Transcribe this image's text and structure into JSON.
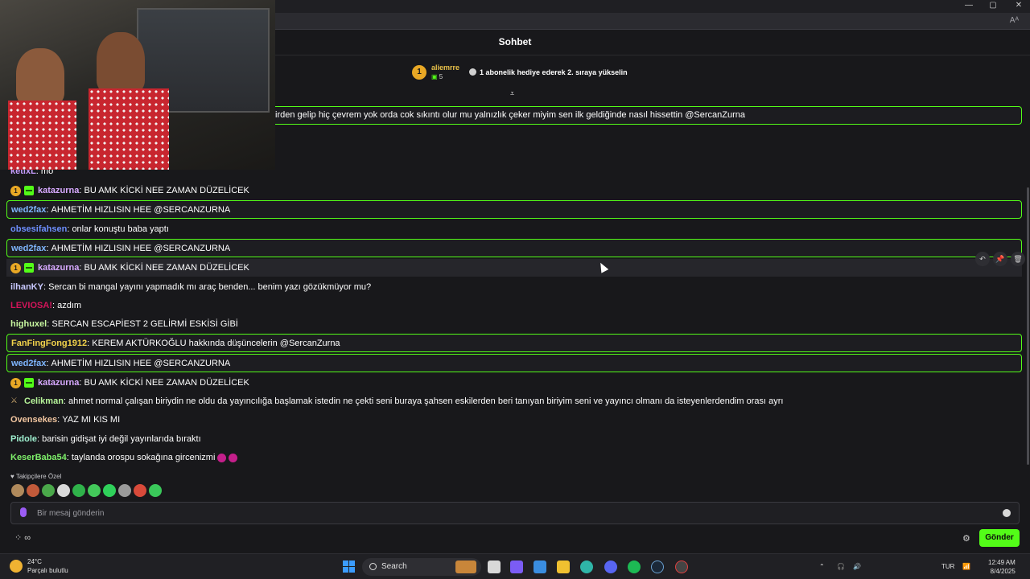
{
  "browser": {
    "reader_label": "Aᴬ",
    "window_controls": {
      "minimize": "—",
      "maximize": "▢",
      "close": "✕"
    }
  },
  "chat": {
    "title": "Sohbet",
    "gift_leaderboard": {
      "rank": "1",
      "user": "aliemrre",
      "count": "5",
      "promo": "1 abonelik hediye ederek 2. sıraya yükselin"
    },
    "pinned_toggle": "⩡",
    "pinned_message": "irden gelip hiç çevrem yok orda cok sıkıntı olur mu yalnızlık çeker miyim sen ilk geldiğinde nasıl hissettin @SercanZurna",
    "messages": [
      {
        "user": "ketixL",
        "color": "#c79dff",
        "text": "mo",
        "badges": []
      },
      {
        "user": "katazurna",
        "color": "#d7a9ff",
        "text": "BU AMK KİCKİ NEE ZAMAN DÜZELİCEK",
        "badges": [
          "1",
          "gift"
        ]
      },
      {
        "user": "wed2fax",
        "color": "#7fb6ff",
        "text": "AHMETİM HIZLISIN HEE @SERCANZURNA",
        "badges": [],
        "highlight": true
      },
      {
        "user": "obsesifahsen",
        "color": "#6e8fff",
        "text": "onlar konuştu baba yaptı",
        "badges": []
      },
      {
        "user": "wed2fax",
        "color": "#7fb6ff",
        "text": "AHMETİM HIZLISIN HEE @SERCANZURNA",
        "badges": [],
        "highlight": true
      },
      {
        "user": "katazurna",
        "color": "#d7a9ff",
        "text": "BU AMK KİCKİ NEE ZAMAN DÜZELİCEK",
        "badges": [
          "1",
          "gift"
        ],
        "hover": true
      },
      {
        "user": "ilhanKY",
        "color": "#c9c9ff",
        "text": "Sercan bi mangal yayını yapmadık mı araç benden... benim yazı gözükmüyor mu?",
        "badges": []
      },
      {
        "user": "LEVIOSA!",
        "color": "#d4145a",
        "text": "azdım",
        "badges": []
      },
      {
        "user": "highuxel",
        "color": "#c8f7a0",
        "text": "SERCAN ESCAPİEST 2 GELİRMİ ESKİSİ GİBİ",
        "badges": []
      },
      {
        "user": "FanFingFong1912",
        "color": "#f2d34b",
        "text": "KEREM AKTÜRKOĞLU hakkında düşüncelerin @SercanZurna",
        "badges": [],
        "highlight": true
      },
      {
        "user": "wed2fax",
        "color": "#7fb6ff",
        "text": "AHMETİM HIZLISIN HEE @SERCANZURNA",
        "badges": [],
        "highlight": true
      },
      {
        "user": "katazurna",
        "color": "#d7a9ff",
        "text": "BU AMK KİCKİ NEE ZAMAN DÜZELİCEK",
        "badges": [
          "1",
          "gift"
        ]
      },
      {
        "user": "Celikman",
        "color": "#b7f59a",
        "text": "ahmet normal çalışan biriydin ne oldu da yayıncılığa başlamak istedin ne çekti seni buraya şahsen eskilerden beri tanıyan biriyim seni ve yayıncı olmanı da isteyenlerdendim orası ayrı",
        "badges": [
          "sword"
        ]
      },
      {
        "user": "Ovensekes",
        "color": "#f2c6a0",
        "text": "YAZ MI KIS MI",
        "badges": []
      },
      {
        "user": "Pidole",
        "color": "#9ff0d0",
        "text": "barisin gidişat iyi değil yayınlarıda bıraktı",
        "badges": []
      },
      {
        "user": "KeserBaba54",
        "color": "#7ef06a",
        "text": "taylanda orospu sokağına gircenizmi",
        "badges": [],
        "emotes": 2
      }
    ],
    "hover_tools": [
      "↶",
      "📌",
      "🗑"
    ],
    "followers_only_label": "Takipçilere Özel",
    "emote_colors": [
      "#b08a5c",
      "#c25a3a",
      "#4aa84a",
      "#d9d9d9",
      "#2fb24a",
      "#43c85a",
      "#2fd05a",
      "#9a9a9a",
      "#d84a3a",
      "#3ac85a"
    ],
    "input": {
      "placeholder": "Bir mesaj gönderin",
      "value": ""
    },
    "bottom_icons": "⁘ ∞",
    "settings_icon": "⚙",
    "send_label": "Gönder",
    "accent": "#53fc18"
  },
  "taskbar": {
    "weather_temp": "24°C",
    "weather_desc": "Parçalı bulutlu",
    "search_label": "Search",
    "language": "TUR",
    "time": "12:49 AM",
    "date": "8/4/2025"
  }
}
